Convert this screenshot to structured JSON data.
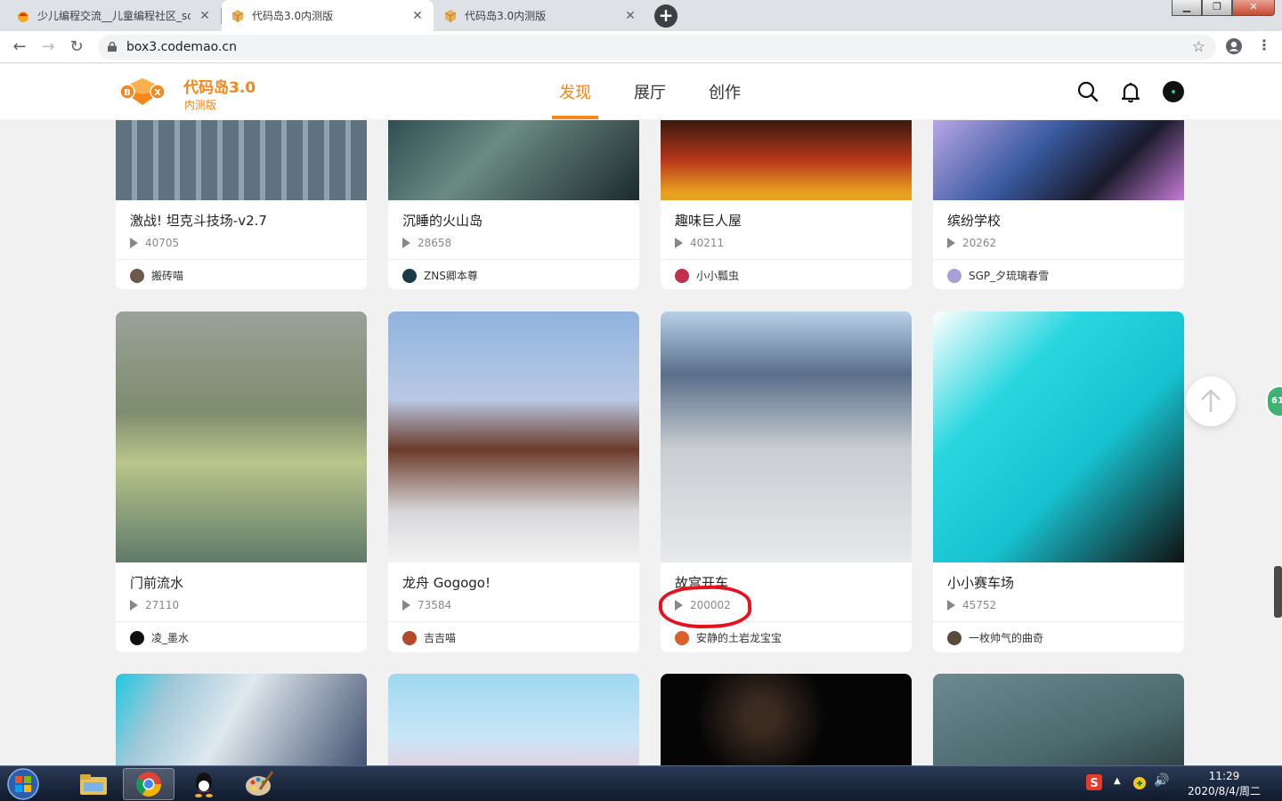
{
  "browser": {
    "tabs": [
      {
        "title": "少儿编程交流__儿童编程社区_scratch",
        "active": false,
        "icon": "codemao-favicon"
      },
      {
        "title": "代码岛3.0内测版",
        "active": true,
        "icon": "box3-favicon"
      },
      {
        "title": "代码岛3.0内测版",
        "active": false,
        "icon": "box3-favicon"
      }
    ],
    "new_tab": "+",
    "url": "box3.codemao.cn",
    "window_buttons": {
      "minimize": "▁",
      "maximize": "❐",
      "close": "✕"
    }
  },
  "site": {
    "brand": {
      "title": "代码岛3.0",
      "subtitle": "内测版",
      "logo_letters": [
        "B",
        "X"
      ]
    },
    "nav": [
      {
        "label": "发现",
        "active": true
      },
      {
        "label": "展厅",
        "active": false
      },
      {
        "label": "创作",
        "active": false
      }
    ],
    "icons": [
      "search-icon",
      "bell-icon",
      "user-avatar"
    ],
    "accent_color": "#f7861b"
  },
  "cards": [
    {
      "title": "激战! 坦克斗技场-v2.7",
      "plays": "40705",
      "author": "搬砖喵"
    },
    {
      "title": "沉睡的火山岛",
      "plays": "28658",
      "author": "ZNS卿本尊"
    },
    {
      "title": "趣味巨人屋",
      "plays": "40211",
      "author": "小小瓢虫"
    },
    {
      "title": "缤纷学校",
      "plays": "20262",
      "author": "SGP_夕琉璃春雪"
    },
    {
      "title": "门前流水",
      "plays": "27110",
      "author": "凌_墨水"
    },
    {
      "title": "龙舟 Gogogo!",
      "plays": "73584",
      "author": "吉吉喵"
    },
    {
      "title": "故宫开车",
      "plays": "200002",
      "author": "安静的土岩龙宝宝"
    },
    {
      "title": "小小赛车场",
      "plays": "45752",
      "author": "一枚帅气的曲奇"
    }
  ],
  "side": {
    "badge": "61"
  },
  "taskbar": {
    "apps": [
      "windows-start",
      "file-explorer",
      "chrome",
      "qq",
      "paint"
    ],
    "time": "11:29",
    "date": "2020/8/4/周二"
  }
}
